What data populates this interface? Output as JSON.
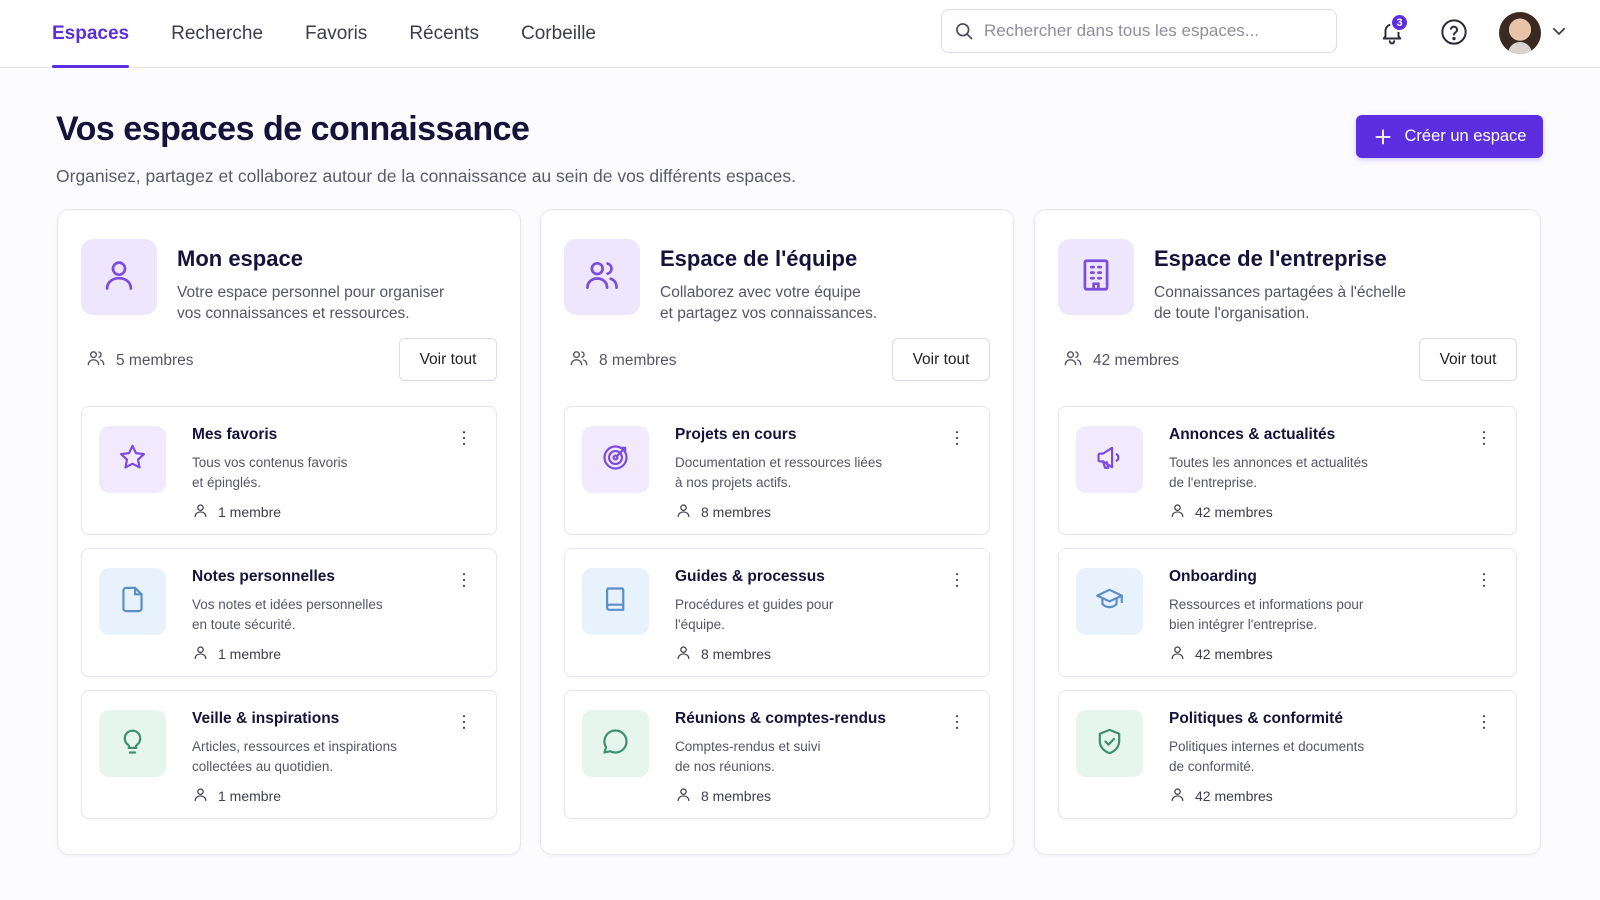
{
  "nav": {
    "tabs": [
      {
        "label": "Espaces"
      },
      {
        "label": "Recherche"
      },
      {
        "label": "Favoris"
      },
      {
        "label": "Récents"
      },
      {
        "label": "Corbeille"
      }
    ],
    "active_tab": "Espaces",
    "search_placeholder": "Rechercher dans tous les espaces...",
    "notifications_count": "3"
  },
  "header": {
    "title": "Vos espaces de connaissance",
    "subtitle": "Organisez, partagez et collaborez autour de la connaissance au sein de vos différents espaces.",
    "create_button": "Créer un espace"
  },
  "colors": {
    "accent": "#5b2ee0",
    "icon_purple": "#7c4ddb",
    "icon_blue": "#5b8ec9",
    "icon_green": "#3f8f6e"
  },
  "spaces": [
    {
      "title": "Mon espace",
      "desc_line1": "Votre espace personnel pour organiser",
      "desc_line2": "vos connaissances et ressources.",
      "icon": "user-icon",
      "members": "5 membres",
      "view_all": "Voir tout",
      "items": [
        {
          "title": "Mes favoris",
          "desc_line1": "Tous vos contenus favoris",
          "desc_line2": "et épinglés.",
          "members": "1 membre",
          "icon": "star-icon"
        },
        {
          "title": "Notes personnelles",
          "desc_line1": "Vos notes et idées personnelles",
          "desc_line2": "en toute sécurité.",
          "members": "1 membre",
          "icon": "file-icon"
        },
        {
          "title": "Veille & inspirations",
          "desc_line1": "Articles, ressources et inspirations",
          "desc_line2": "collectées au quotidien.",
          "members": "1 membre",
          "icon": "lightbulb-icon"
        }
      ]
    },
    {
      "title": "Espace de l'équipe",
      "desc_line1": "Collaborez avec votre équipe",
      "desc_line2": "et partagez vos connaissances.",
      "icon": "team-icon",
      "members": "8 membres",
      "view_all": "Voir tout",
      "items": [
        {
          "title": "Projets en cours",
          "desc_line1": "Documentation et ressources liées",
          "desc_line2": "à nos projets actifs.",
          "members": "8 membres",
          "icon": "target-icon"
        },
        {
          "title": "Guides & processus",
          "desc_line1": "Procédures et guides pour",
          "desc_line2": "l'équipe.",
          "members": "8 membres",
          "icon": "book-icon"
        },
        {
          "title": "Réunions & comptes-rendus",
          "desc_line1": "Comptes-rendus et suivi",
          "desc_line2": "de nos réunions.",
          "members": "8 membres",
          "icon": "chat-bubble-icon"
        }
      ]
    },
    {
      "title": "Espace de l'entreprise",
      "desc_line1": "Connaissances partagées à l'échelle",
      "desc_line2": "de toute l'organisation.",
      "icon": "building-icon",
      "members": "42 membres",
      "view_all": "Voir tout",
      "items": [
        {
          "title": "Annonces & actualités",
          "desc_line1": "Toutes les annonces et actualités",
          "desc_line2": "de l'entreprise.",
          "members": "42 membres",
          "icon": "megaphone-icon"
        },
        {
          "title": "Onboarding",
          "desc_line1": "Ressources et informations pour",
          "desc_line2": "bien intégrer l'entreprise.",
          "members": "42 membres",
          "icon": "graduation-cap-icon"
        },
        {
          "title": "Politiques & conformité",
          "desc_line1": "Politiques internes et documents",
          "desc_line2": "de conformité.",
          "members": "42 membres",
          "icon": "shield-check-icon"
        }
      ]
    }
  ]
}
